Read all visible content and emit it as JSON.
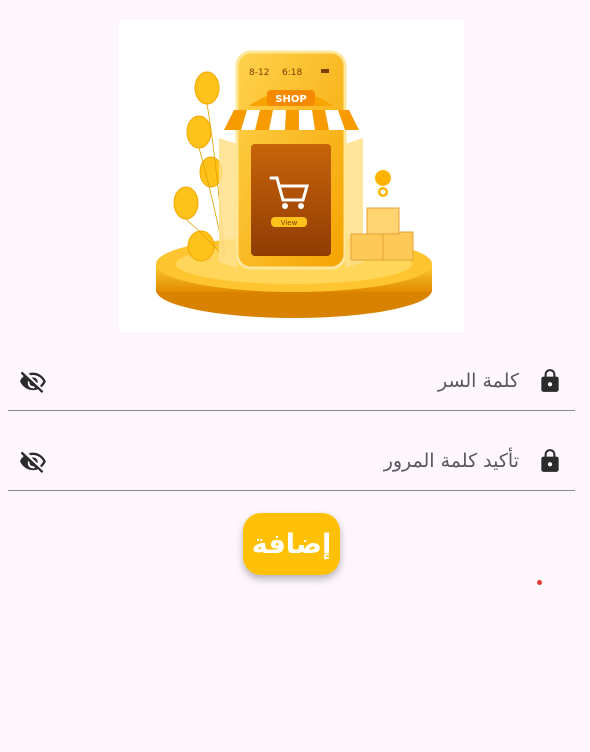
{
  "hero": {
    "phone_time_left": "8-12",
    "phone_time_right": "6:18",
    "shop_sign": "SHOP",
    "view_button": "View"
  },
  "form": {
    "password": {
      "placeholder": "كلمة السر",
      "lock_icon": "lock-icon",
      "toggle_icon": "eye-off-icon"
    },
    "confirm_password": {
      "placeholder": "تأكيد كلمة المرور",
      "lock_icon": "lock-icon",
      "toggle_icon": "eye-off-icon"
    },
    "submit_label": "إضافة"
  },
  "colors": {
    "accent": "#ffc107",
    "background": "#fdf7fd",
    "underline": "#8a8a8a",
    "text": "#5a5760",
    "status_dot": "#e53935"
  }
}
